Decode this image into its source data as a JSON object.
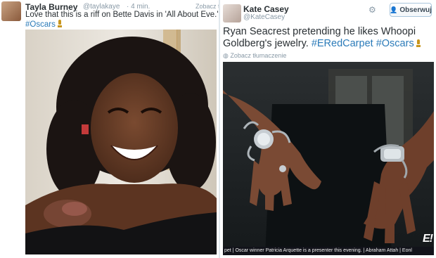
{
  "left_tweet": {
    "name": "Tayla Burney",
    "handle": "@taylakaye",
    "time": "· 4 min.",
    "translate_link": "Zobacz tł",
    "text_line1": "Love that this is a riff on Bette Davis in 'All About Eve.' Glam Whoopi",
    "hashtag": "#Oscars"
  },
  "right_tweet": {
    "name": "Kate Casey",
    "handle": "@KateCasey",
    "follow_label": "Obserwuj",
    "text_line1": "Ryan Seacrest pretending he likes Whoopi",
    "text_line2_plain": "Goldberg's jewelry.",
    "hashtag1": "#ERedCarpet",
    "hashtag2": "#Oscars",
    "translate_link": "Zobacz tłumaczenie"
  },
  "tv_overlay": {
    "ticker_text": "pet  |  Oscar winner Patricia Arquette is a presenter this evening.  |  Abraham Attah  |  Eonl",
    "channel_logo": "E!"
  },
  "icons": {
    "gear": "gear-icon",
    "follow": "add-user-icon",
    "trophy": "oscar-trophy-icon",
    "globe": "globe-icon"
  },
  "colors": {
    "hashtag": "#2b7bb9",
    "text": "#292f33",
    "meta": "#8899a6"
  }
}
